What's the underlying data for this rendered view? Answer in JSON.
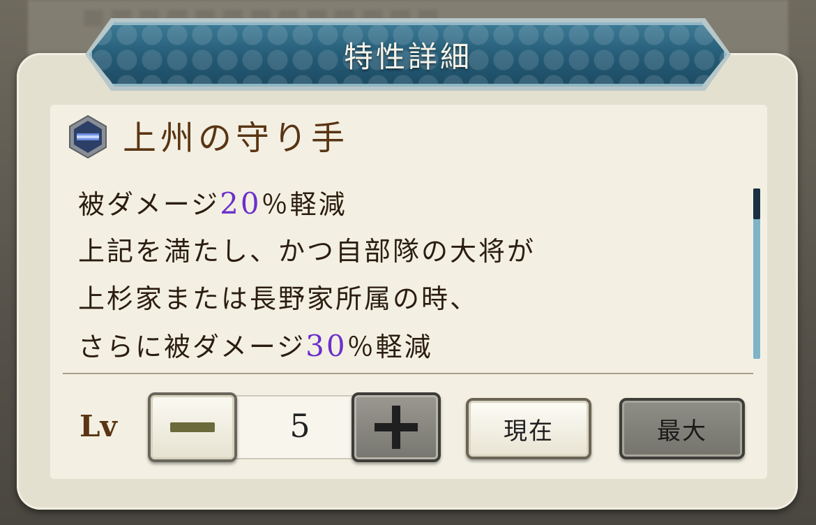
{
  "dialog": {
    "title": "特性詳細"
  },
  "skill": {
    "icon": "blue-hexagon-icon",
    "name": "上州の守り手",
    "description": [
      {
        "before": "被ダメージ",
        "number": "20",
        "after": "％軽減"
      },
      {
        "text": "上記を満たし、かつ自部隊の大将が"
      },
      {
        "text": "上杉家または長野家所属の時、"
      },
      {
        "before": "さらに被ダメージ",
        "number": "30",
        "after": "％軽減"
      }
    ]
  },
  "level": {
    "label": "Lv",
    "value": "5",
    "current_label": "現在",
    "max_label": "最大"
  },
  "colors": {
    "title_banner": "#245a75",
    "highlight_number": "#6b2fc9",
    "skill_name": "#5a3413"
  }
}
